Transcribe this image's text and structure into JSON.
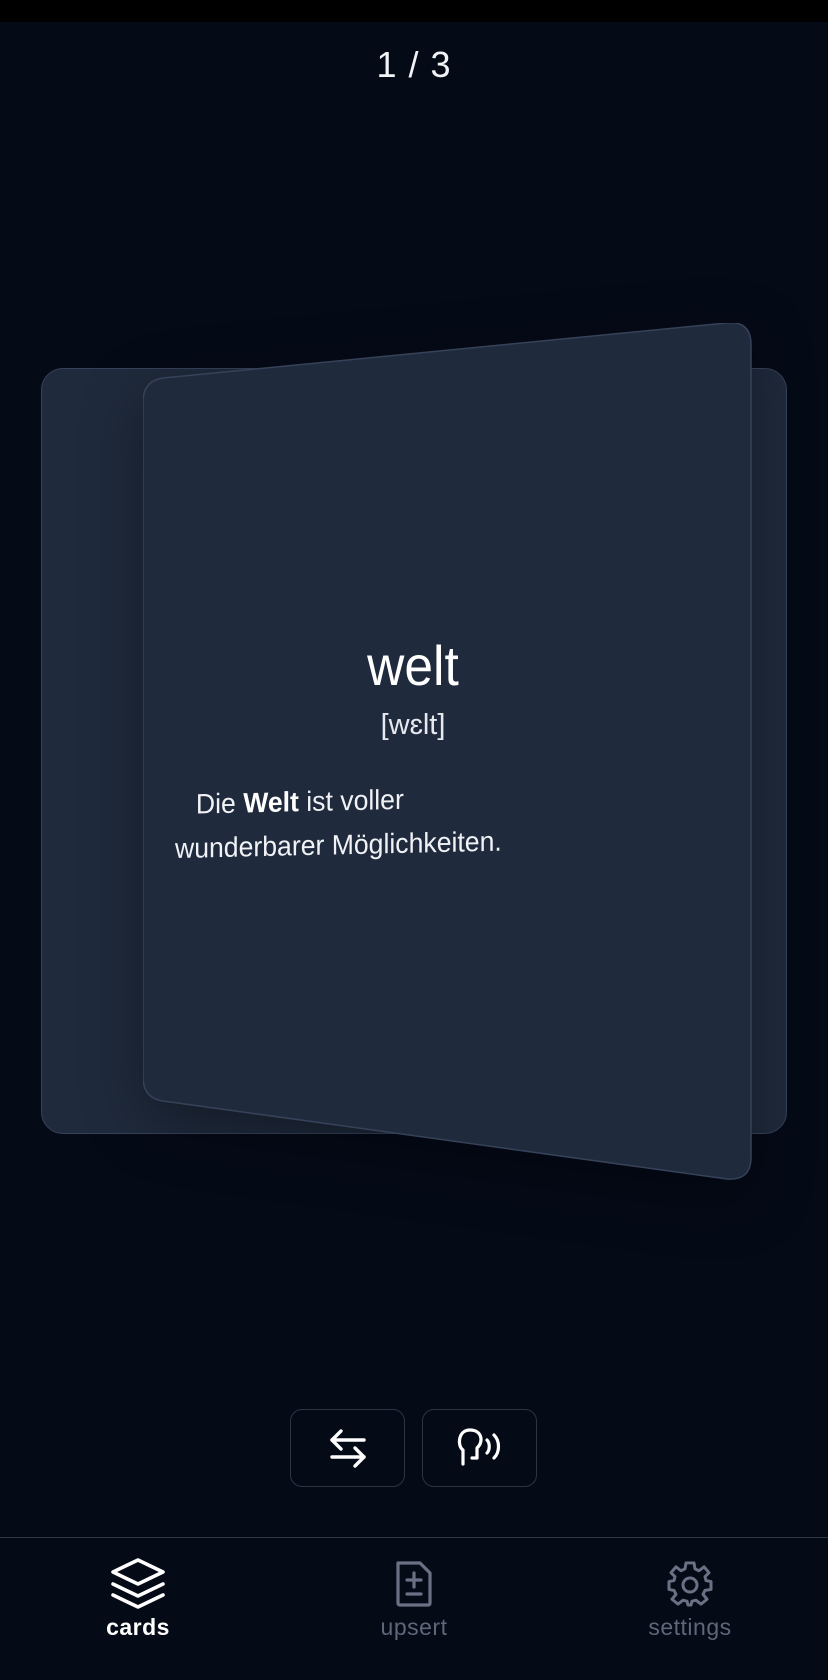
{
  "progress": {
    "counter_text": "1 / 3",
    "current": 1,
    "total": 3
  },
  "card": {
    "word": "welt",
    "phonetic": "[wɛlt]",
    "example": {
      "before": "Die ",
      "highlight": "Welt",
      "after": " ist voller wunderbarer Möglichkeiten."
    }
  },
  "controls": [
    {
      "icon": "swap-arrows-icon"
    },
    {
      "icon": "speak-icon"
    }
  ],
  "nav": {
    "items": [
      {
        "label": "cards",
        "icon": "stack-icon",
        "active": true
      },
      {
        "label": "upsert",
        "icon": "file-diff-icon",
        "active": false
      },
      {
        "label": "settings",
        "icon": "gear-icon",
        "active": false
      }
    ]
  },
  "colors": {
    "background": "#050a17",
    "card": "#202a3d",
    "card_border": "#36425a",
    "text": "#ffffff",
    "nav_inactive": "#5f6678"
  }
}
